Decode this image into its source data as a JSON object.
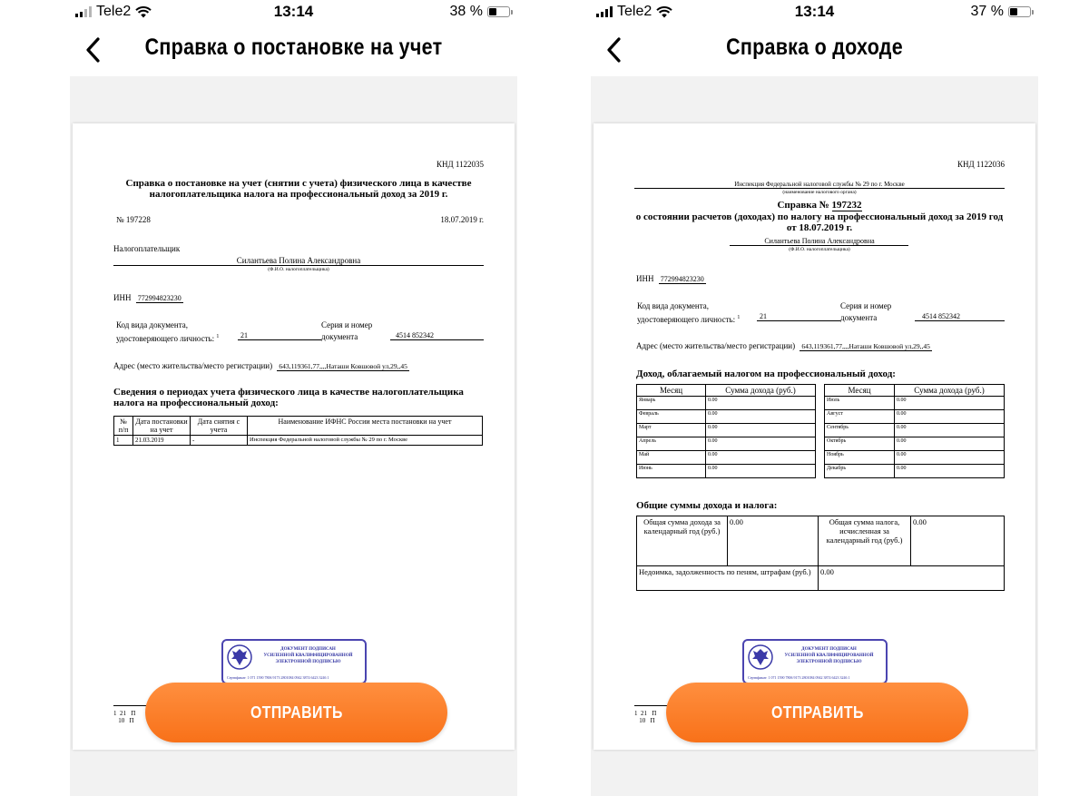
{
  "left": {
    "status": {
      "carrier": "Tele2",
      "time": "13:14",
      "battery": "38 %",
      "battery_level": 0.38
    },
    "nav": {
      "title": "Справка о постановке на учет"
    },
    "document": {
      "knd": "КНД 1122035",
      "title": "Справка о постановке на учет (снятии с учета) физического лица в качестве налогоплательщика налога на профессиональный доход за 2019 г.",
      "number": "№ 197228",
      "date": "18.07.2019 г.",
      "taxpayer_label": "Налогоплательщик",
      "taxpayer_name": "Силантьева Полина Александровна",
      "taxpayer_caption": "(Ф.И.О. налогоплательщика)",
      "inn_label": "ИНН",
      "inn_value": "772994823230",
      "doc_code_label_1": "Код вида документа,",
      "doc_code_label_2": "удостоверяющего личность:",
      "doc_code_sup": "1",
      "doc_code_value": "21",
      "series_label_1": "Серия и номер",
      "series_label_2": "документа",
      "series_value": "4514  852342",
      "address_label": "Адрес (место жительства/место регистрации)",
      "address_value": "643,119361,77,,,,Наташи Ковшовой ул,29,,45",
      "periods_title": "Сведения о периодах учета физического лица в качестве налогоплательщика налога на профессиональный доход:",
      "table_headers": [
        "№ п/п",
        "Дата постановки на учет",
        "Дата снятия с учета",
        "Наименование ИФНС России места постановки на учет"
      ],
      "table_rows": [
        [
          "1",
          "21.03.2019",
          "-",
          "Инспекция Федеральной налоговой службы № 29 по г. Москве"
        ]
      ],
      "stamp": {
        "line1": "ДОКУМЕНТ ПОДПИСАН",
        "line2": "УСИЛЕННОЙ КВАЛИФИЦИРОВАННОЙ",
        "line3": "ЭЛЕКТРОННОЙ ПОДПИСЬЮ",
        "cert": "Сертификат: 1 071 1590 7806 9173 2801084 0942 3874 6423 3246 1"
      },
      "footnote_1": "1  21   П",
      "footnote_2": "   10   П"
    },
    "button": "ОТПРАВИТЬ"
  },
  "right": {
    "status": {
      "carrier": "Tele2",
      "time": "13:14",
      "battery": "37 %",
      "battery_level": 0.37
    },
    "nav": {
      "title": "Справка о доходе"
    },
    "document": {
      "knd": "КНД 1122036",
      "inspection": "Инспекция Федеральной налоговой службы № 29 по г. Москве",
      "inspection_caption": "(наименование налогового органа)",
      "title_prefix": "Справка №",
      "title_number": "197232",
      "title_rest": "о состоянии расчетов (доходах) по налогу на профессиональный доход за 2019 год от 18.07.2019 г.",
      "taxpayer_name": "Силантьева Полина Александровна",
      "taxpayer_caption": "(Ф.И.О. налогоплательщика)",
      "inn_label": "ИНН",
      "inn_value": "772994823230",
      "doc_code_label_1": "Код вида документа,",
      "doc_code_label_2": "удостоверяющего личность:",
      "doc_code_sup": "1",
      "doc_code_value": "21",
      "series_label_1": "Серия и номер",
      "series_label_2": "документа",
      "series_value": "4514  852342",
      "address_label": "Адрес (место жительства/место регистрации)",
      "address_value": "643,119361,77,,,,Наташи Ковшовой ул,29,,45",
      "income_title": "Доход, облагаемый налогом на профессиональный доход:",
      "month_header": "Месяц",
      "sum_header": "Сумма дохода (руб.)",
      "months_left": [
        [
          "Январь",
          "0.00"
        ],
        [
          "Февраль",
          "0.00"
        ],
        [
          "Март",
          "0.00"
        ],
        [
          "Апрель",
          "0.00"
        ],
        [
          "Май",
          "0.00"
        ],
        [
          "Июнь",
          "0.00"
        ]
      ],
      "months_right": [
        [
          "Июль",
          "0.00"
        ],
        [
          "Август",
          "0.00"
        ],
        [
          "Сентябрь",
          "0.00"
        ],
        [
          "Октябрь",
          "0.00"
        ],
        [
          "Ноябрь",
          "0.00"
        ],
        [
          "Декабрь",
          "0.00"
        ]
      ],
      "totals_title": "Общие суммы дохода и налога:",
      "total_income_label": "Общая сумма дохода за календарный год (руб.)",
      "total_income_value": "0.00",
      "total_tax_label": "Общая сумма налога, исчисленная за календарный год (руб.)",
      "total_tax_value": "0.00",
      "arrears_label": "Недоимка, задолженность по пеням, штрафам (руб.)",
      "arrears_value": "0.00",
      "stamp": {
        "line1": "ДОКУМЕНТ ПОДПИСАН",
        "line2": "УСИЛЕННОЙ КВАЛИФИЦИРОВАННОЙ",
        "line3": "ЭЛЕКТРОННОЙ ПОДПИСЬЮ",
        "cert": "Сертификат: 1 071 1590 7806 9173 2801084 0942 3874 6423 3246 1"
      },
      "footnote_1": "1  21   П",
      "footnote_2": "   10   П"
    },
    "button": "ОТПРАВИТЬ"
  }
}
